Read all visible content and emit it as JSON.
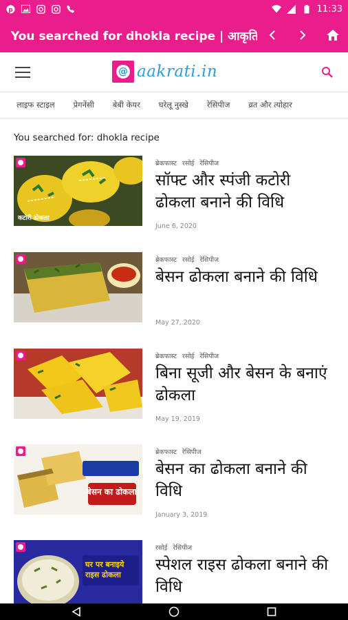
{
  "status_bar": {
    "time": "11:33",
    "left_icons": [
      "pinterest-icon",
      "gallery-icon",
      "instagram-icon",
      "instagram-icon",
      "call-icon"
    ],
    "right_icons": [
      "wifi-icon",
      "signal-icon",
      "battery-icon"
    ]
  },
  "app_bar": {
    "title": "You searched for dhokla recipe | आकृति",
    "back_icon": "chevron-left-icon",
    "forward_icon": "chevron-right-icon",
    "home_icon": "home-icon",
    "color": "#e91e8c"
  },
  "header": {
    "logo_text": "aakrati.in",
    "logo_mark": "@",
    "menu_icon": "hamburger-menu-icon",
    "search_icon": "search-icon"
  },
  "category_nav": [
    "लाइफ स्टाइल",
    "प्रेगनेंसी",
    "बेबी केयर",
    "घरेलू नुस्खे",
    "रेसिपीज",
    "व्रत और त्योहार"
  ],
  "search_heading": "You searched for: dhokla recipe",
  "articles": [
    {
      "categories": [
        "ब्रेकफास्ट",
        "रसोई",
        "रेसिपीज"
      ],
      "title": "सॉफ्ट और स्पंजी कटोरी ढोकला बनाने की विधि",
      "date": "June 6, 2020",
      "thumb_caption": "कटोरी ढोकला"
    },
    {
      "categories": [
        "ब्रेकफास्ट",
        "रसोई",
        "रेसिपीज"
      ],
      "title": "बेसन ढोकला बनाने की विधि",
      "date": "May 27, 2020",
      "thumb_caption": ""
    },
    {
      "categories": [
        "ब्रेकफास्ट",
        "रसोई",
        "रेसिपीज"
      ],
      "title": "बिना सूजी और बेसन के बनाएं ढोकला",
      "date": "May 19, 2019",
      "thumb_caption": ""
    },
    {
      "categories": [
        "ब्रेकफास्ट",
        "रेसिपीज"
      ],
      "title": "बेसन का ढोकला बनाने की विधि",
      "date": "January 3, 2019",
      "thumb_caption": "बेसन का ढोकला"
    },
    {
      "categories": [
        "रसोई",
        "रेसिपीज"
      ],
      "title": "स्पेशल राइस ढोकला बनाने की विधि",
      "date": "",
      "thumb_caption": "घर पर बनाइये राइस ढोकला"
    }
  ],
  "nav_bar": {
    "back_icon": "nav-back-icon",
    "home_icon": "nav-home-icon",
    "recents_icon": "nav-recents-icon"
  }
}
